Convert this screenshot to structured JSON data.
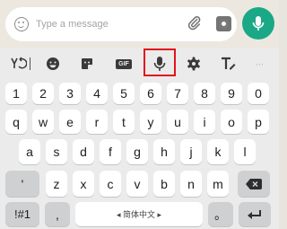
{
  "composer": {
    "placeholder": "Type a message",
    "emoji_icon": "smiley-icon",
    "attach_icon": "paperclip-icon",
    "camera_icon": "camera-icon",
    "mic_icon": "microphone-icon",
    "accent_color": "#1aa886"
  },
  "toolbar": {
    "translate_icon": "translate-icon",
    "emoji_icon": "emoji-icon",
    "sticker_icon": "sticker-icon",
    "gif_label": "GIF",
    "voice_icon": "microphone-icon",
    "settings_icon": "gear-icon",
    "text_style_icon": "text-style-icon",
    "more_label": "···",
    "highlight_color": "#e0141e"
  },
  "keyboard": {
    "number_row": [
      "1",
      "2",
      "3",
      "4",
      "5",
      "6",
      "7",
      "8",
      "9",
      "0"
    ],
    "row1": [
      "q",
      "w",
      "e",
      "r",
      "t",
      "y",
      "u",
      "i",
      "o",
      "p"
    ],
    "row2": [
      "a",
      "s",
      "d",
      "f",
      "g",
      "h",
      "j",
      "k",
      "l"
    ],
    "row3": [
      "z",
      "x",
      "c",
      "v",
      "b",
      "n",
      "m"
    ],
    "apostrophe": "'",
    "backspace_icon": "backspace-icon",
    "symbols_label": "!#1",
    "comma": ",",
    "space_label": "◂ 简体中文 ▸",
    "period": "。",
    "enter_icon": "enter-icon"
  }
}
